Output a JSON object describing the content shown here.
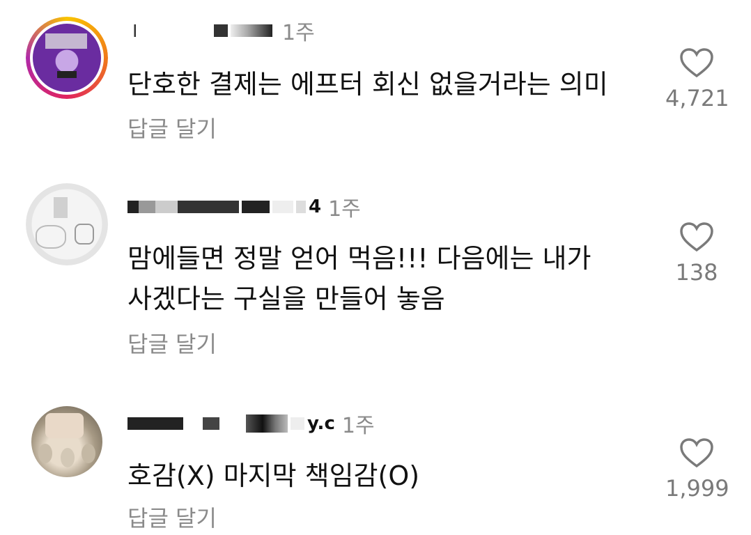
{
  "comments": [
    {
      "username": "i",
      "time": "1주",
      "text": "단호한 결제는 에프터 회신 없을거라는 의미",
      "reply": "답글 달기",
      "likes": "4,721",
      "avatar_colors": [
        "#6a2ca0",
        "#d9b7f0"
      ]
    },
    {
      "username": "4",
      "time": "1주",
      "text": "맘에들면 정말 얻어 먹음!!! 다음에는 내가\n사겠다는 구실을 만들어 놓음",
      "reply": "답글 달기",
      "likes": "138",
      "avatar_colors": [
        "#ececec",
        "#cfcfcf"
      ]
    },
    {
      "username": "y.c",
      "time": "1주",
      "text": "호감(X) 마지막 책임감(O)",
      "reply": "답글 달기",
      "likes": "1,999",
      "avatar_colors": [
        "#b9ae9b",
        "#d8d0c2"
      ]
    }
  ]
}
